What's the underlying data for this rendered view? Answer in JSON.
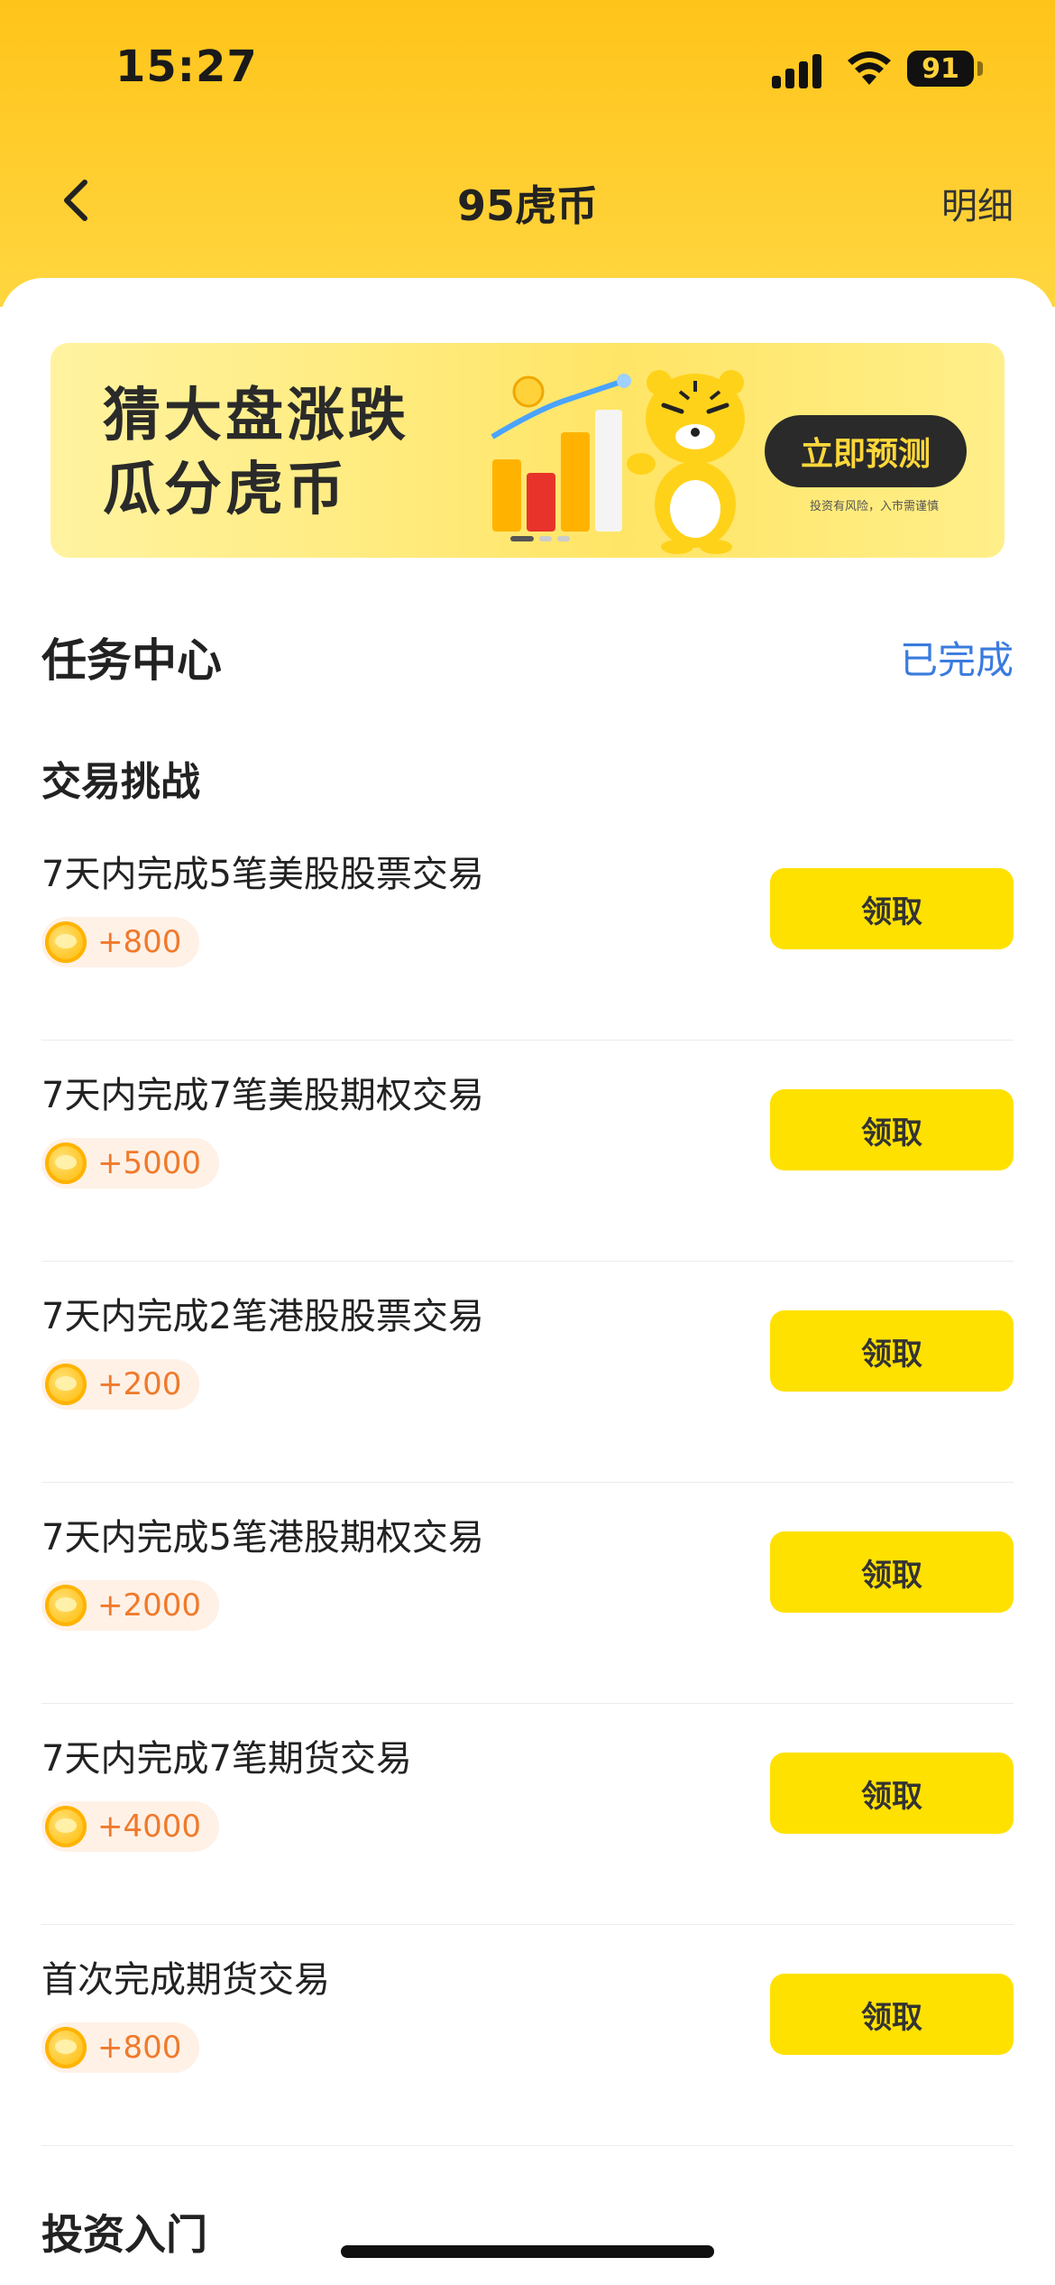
{
  "status_bar": {
    "time": "15:27",
    "battery": "91"
  },
  "nav": {
    "title": "95虎币",
    "detail_label": "明细"
  },
  "banner": {
    "line1": "猜大盘涨跌",
    "line2": "瓜分虎币",
    "button_label": "立即预测",
    "note": "投资有风险，入市需谨慎"
  },
  "task_center": {
    "title": "任务中心",
    "completed_link": "已完成",
    "group_title": "交易挑战",
    "tasks": [
      {
        "title": "7天内完成5笔美股股票交易",
        "reward": "+800",
        "button": "领取"
      },
      {
        "title": "7天内完成7笔美股期权交易",
        "reward": "+5000",
        "button": "领取"
      },
      {
        "title": "7天内完成2笔港股股票交易",
        "reward": "+200",
        "button": "领取"
      },
      {
        "title": "7天内完成5笔港股期权交易",
        "reward": "+2000",
        "button": "领取"
      },
      {
        "title": "7天内完成7笔期货交易",
        "reward": "+4000",
        "button": "领取"
      },
      {
        "title": "首次完成期货交易",
        "reward": "+800",
        "button": "领取"
      }
    ],
    "next_section_title": "投资入门"
  },
  "colors": {
    "header_yellow": "#ffc41a",
    "button_yellow": "#ffe100",
    "link_blue": "#3a7bdf",
    "reward_orange": "#f07a2c"
  }
}
